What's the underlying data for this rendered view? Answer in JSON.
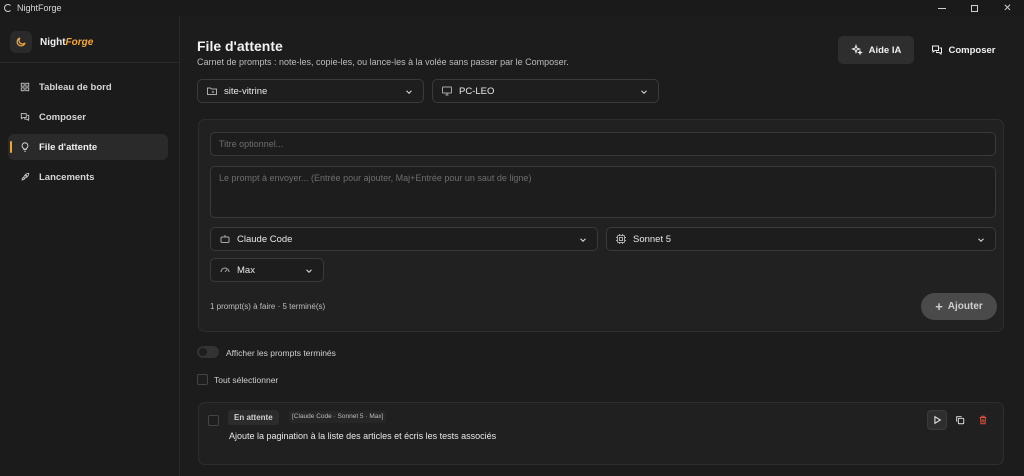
{
  "window": {
    "title": "NightForge"
  },
  "brand": {
    "name_main": "Night",
    "name_accent": "Forge"
  },
  "sidebar": {
    "items": [
      {
        "label": "Tableau de bord",
        "icon": "grid-icon",
        "active": false
      },
      {
        "label": "Composer",
        "icon": "chat-icon",
        "active": false
      },
      {
        "label": "File d'attente",
        "icon": "bulb-icon",
        "active": true
      },
      {
        "label": "Lancements",
        "icon": "rocket-icon",
        "active": false
      }
    ]
  },
  "header": {
    "title": "File d'attente",
    "subtitle": "Carnet de prompts : note-les, copie-les, ou lance-les à la volée sans passer par le Composer.",
    "ai_button": "Aide IA",
    "composer_button": "Composer"
  },
  "filters": {
    "project": "site-vitrine",
    "machine": "PC-LEO"
  },
  "form": {
    "title_placeholder": "Titre optionnel...",
    "prompt_placeholder": "Le prompt à envoyer... (Entrée pour ajouter, Maj+Entrée pour un saut de ligne)",
    "agent": "Claude Code",
    "model": "Sonnet 5",
    "effort": "Max",
    "status": "1 prompt(s) à faire · 5 terminé(s)",
    "add_button": "Ajouter"
  },
  "options": {
    "show_done_label": "Afficher les prompts terminés",
    "show_done": false,
    "select_all_label": "Tout sélectionner"
  },
  "queue": [
    {
      "status": "En attente",
      "meta": "[Claude Code · Sonnet 5 · Max]",
      "text": "Ajoute la pagination à la liste des articles et écris les tests associés"
    }
  ],
  "colors": {
    "accent": "#f2a63a",
    "delete": "#e0503c",
    "background": "#1c1c1c"
  }
}
